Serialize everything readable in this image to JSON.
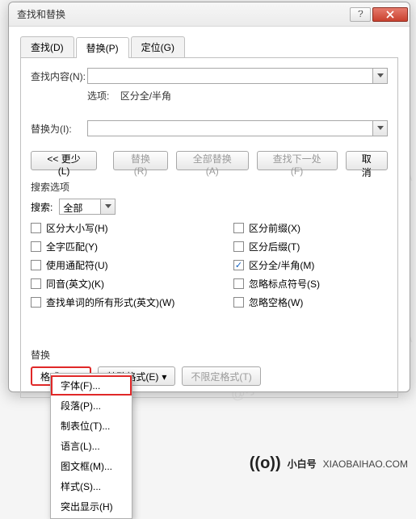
{
  "dialog": {
    "title": "查找和替换"
  },
  "tabs": {
    "find": "查找(D)",
    "replace": "替换(P)",
    "goto": "定位(G)"
  },
  "fields": {
    "find_label": "查找内容(N):",
    "find_value": "",
    "options_label": "选项:",
    "options_value": "区分全/半角",
    "replace_label": "替换为(I):",
    "replace_value": ""
  },
  "buttons": {
    "less": "<<  更少(L)",
    "replace": "替换(R)",
    "replace_all": "全部替换(A)",
    "find_next": "查找下一处(F)",
    "cancel": "取消"
  },
  "search": {
    "section": "搜索选项",
    "search_label": "搜索:",
    "scope": "全部",
    "left": [
      {
        "label": "区分大小写(H)",
        "checked": false,
        "disabled": false
      },
      {
        "label": "全字匹配(Y)",
        "checked": false,
        "disabled": false
      },
      {
        "label": "使用通配符(U)",
        "checked": false,
        "disabled": false
      },
      {
        "label": "同音(英文)(K)",
        "checked": false,
        "disabled": false
      },
      {
        "label": "查找单词的所有形式(英文)(W)",
        "checked": false,
        "disabled": false
      }
    ],
    "right": [
      {
        "label": "区分前缀(X)",
        "checked": false,
        "disabled": false
      },
      {
        "label": "区分后缀(T)",
        "checked": false,
        "disabled": false
      },
      {
        "label": "区分全/半角(M)",
        "checked": true,
        "disabled": false
      },
      {
        "label": "忽略标点符号(S)",
        "checked": false,
        "disabled": false
      },
      {
        "label": "忽略空格(W)",
        "checked": false,
        "disabled": false
      }
    ]
  },
  "replace_section": {
    "label": "替换",
    "format_btn": "格式(O)",
    "special_btn": "特殊格式(E)",
    "no_format_btn": "不限定格式(T)"
  },
  "format_menu": [
    "字体(F)...",
    "段落(P)...",
    "制表位(T)...",
    "语言(L)...",
    "图文框(M)...",
    "样式(S)...",
    "突出显示(H)"
  ],
  "watermark": {
    "brand": "小白号",
    "url": "XIAOBAIHAO.COM",
    "bgtext": "@小白号  XIAOBAIHAO.COM"
  }
}
